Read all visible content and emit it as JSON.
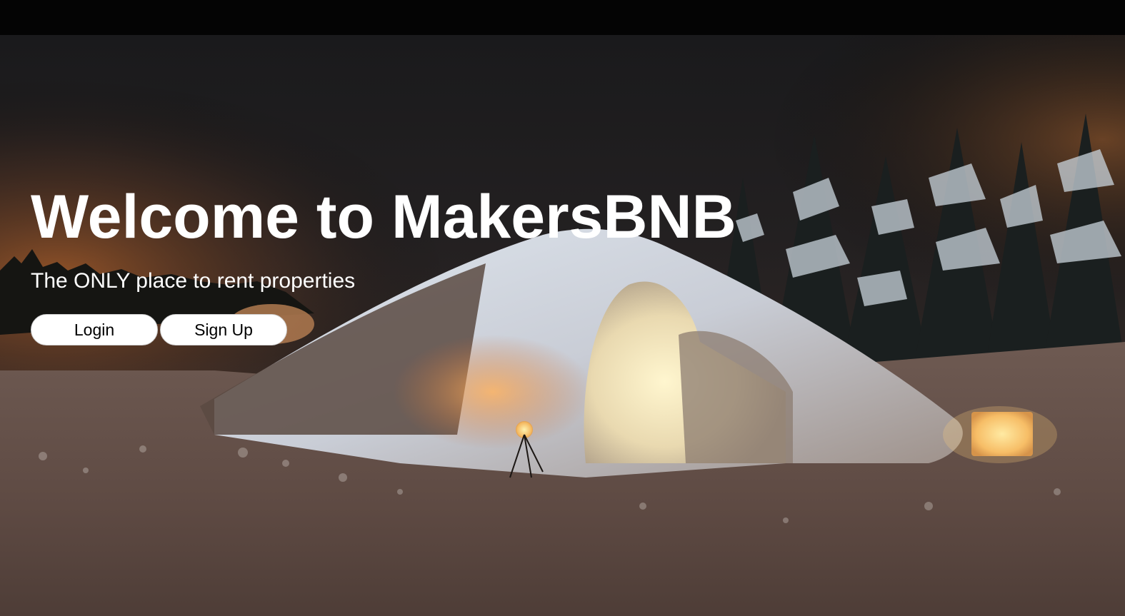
{
  "hero": {
    "title": "Welcome to MakersBNB",
    "subtitle": "The ONLY place to rent properties",
    "background_image": "snow igloo at night with lanterns and snowy pine trees"
  },
  "buttons": {
    "login_label": "Login",
    "signup_label": "Sign Up"
  },
  "colors": {
    "button_bg": "#ffffff",
    "button_text": "#000000",
    "title_text": "#ffffff",
    "top_bar": "#040404"
  }
}
